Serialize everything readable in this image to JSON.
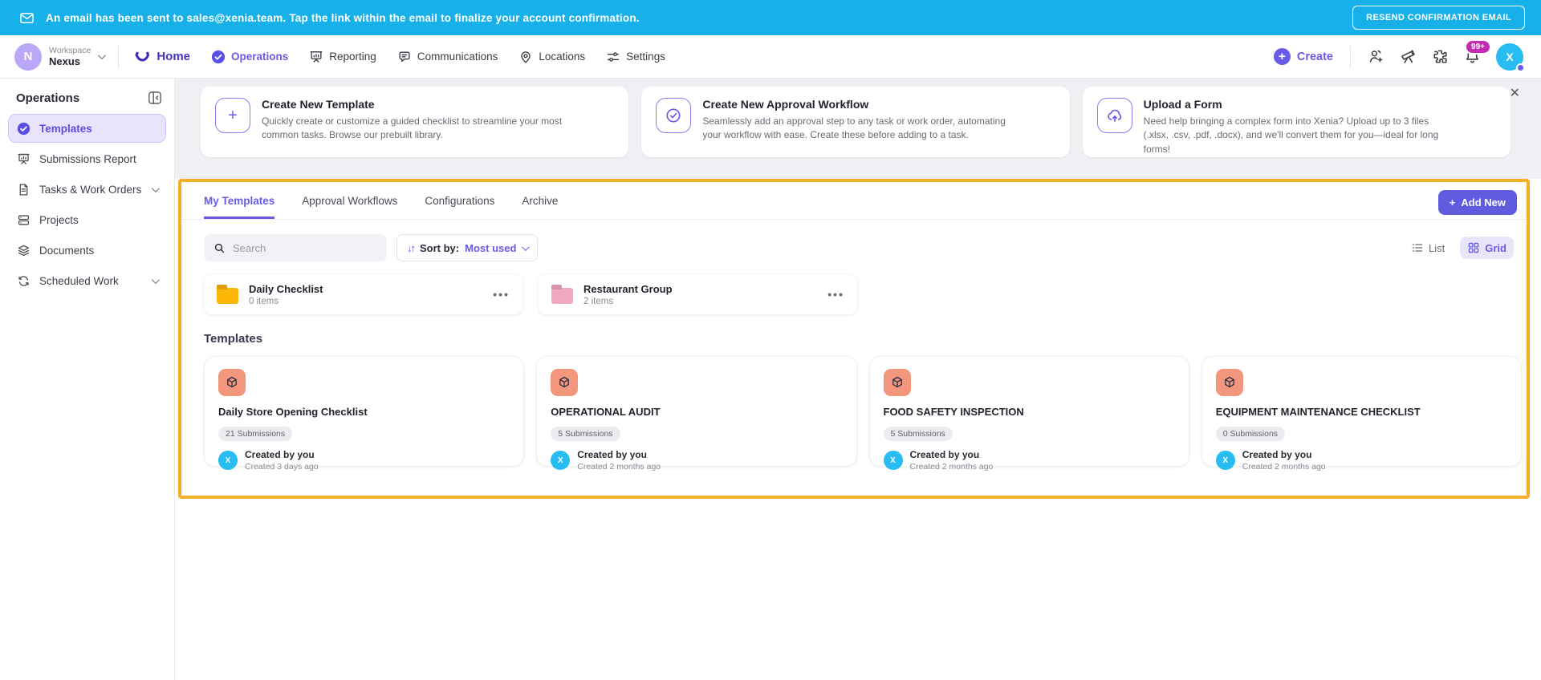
{
  "banner": {
    "message": "An email has been sent to sales@xenia.team. Tap the link within the email to finalize your account confirmation.",
    "resend_button": "RESEND CONFIRMATION EMAIL",
    "bg_color": "#17b0e9"
  },
  "header": {
    "workspace_label": "Workspace",
    "workspace_name": "Nexus",
    "workspace_initial": "N",
    "nav": [
      {
        "label": "Home"
      },
      {
        "label": "Operations"
      },
      {
        "label": "Reporting"
      },
      {
        "label": "Communications"
      },
      {
        "label": "Locations"
      },
      {
        "label": "Settings"
      }
    ],
    "create_label": "Create",
    "notification_badge": "99+",
    "avatar_initial": "X"
  },
  "sidebar": {
    "title": "Operations",
    "items": [
      {
        "label": "Templates"
      },
      {
        "label": "Submissions Report"
      },
      {
        "label": "Tasks & Work Orders"
      },
      {
        "label": "Projects"
      },
      {
        "label": "Documents"
      },
      {
        "label": "Scheduled Work"
      }
    ]
  },
  "info_cards": [
    {
      "title": "Create New Template",
      "description": "Quickly create or customize a guided checklist to streamline your most common tasks. Browse our prebuilt library."
    },
    {
      "title": "Create New Approval Workflow",
      "description": "Seamlessly add an approval step to any task or work order, automating your workflow with ease. Create these before adding to a task."
    },
    {
      "title": "Upload a Form",
      "description": "Need help bringing a complex form into Xenia? Upload up to 3 files (.xlsx, .csv, .pdf, .docx), and we'll convert them for you—ideal for long forms!"
    }
  ],
  "panel": {
    "tabs": [
      {
        "label": "My Templates"
      },
      {
        "label": "Approval Workflows"
      },
      {
        "label": "Configurations"
      },
      {
        "label": "Archive"
      }
    ],
    "add_new_label": "Add New",
    "search_placeholder": "Search",
    "sort_label": "Sort by:",
    "sort_value": "Most used",
    "view_list_label": "List",
    "view_grid_label": "Grid",
    "folders": [
      {
        "name": "Daily Checklist",
        "count": "0 items",
        "color": "#fcb607"
      },
      {
        "name": "Restaurant Group",
        "count": "2 items",
        "color": "#f2a7c3"
      }
    ],
    "section_title": "Templates",
    "templates": [
      {
        "title": "Daily Store Opening Checklist",
        "submissions": "21 Submissions",
        "created_by": "Created by you",
        "created_at": "Created 3 days ago",
        "avatar_initial": "X"
      },
      {
        "title": "OPERATIONAL AUDIT",
        "submissions": "5 Submissions",
        "created_by": "Created by you",
        "created_at": "Created 2 months ago",
        "avatar_initial": "X"
      },
      {
        "title": "FOOD SAFETY INSPECTION",
        "submissions": "5 Submissions",
        "created_by": "Created by you",
        "created_at": "Created 2 months ago",
        "avatar_initial": "X"
      },
      {
        "title": "EQUIPMENT MAINTENANCE CHECKLIST",
        "submissions": "0 Submissions",
        "created_by": "Created by you",
        "created_at": "Created 2 months ago",
        "avatar_initial": "X"
      }
    ]
  },
  "icons": {
    "close": "✕",
    "ellipsis": "•••",
    "plus": "+",
    "sort_arrows": "↓↑"
  },
  "colors": {
    "accent_purple": "#6a5ae8",
    "panel_border_yellow": "#f2b028",
    "badge_magenta": "#c32bb0",
    "avatar_cyan": "#27bdf2",
    "template_icon_salmon": "#f2967c",
    "banner_cyan": "#17b0e9"
  }
}
